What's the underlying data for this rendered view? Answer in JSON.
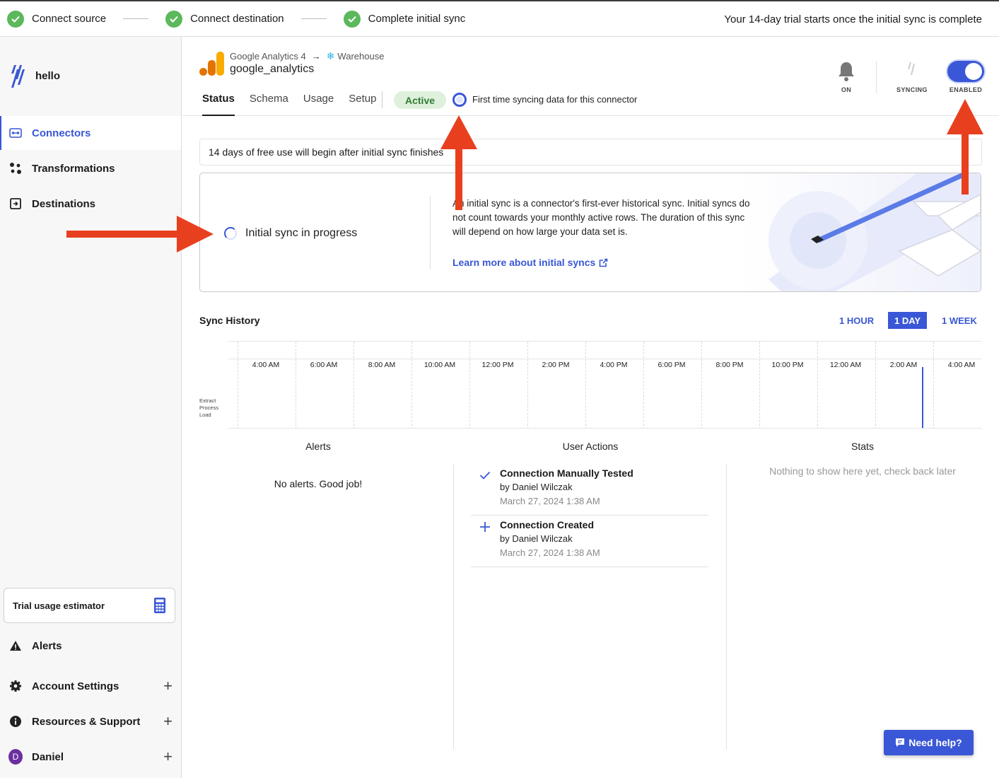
{
  "progress": {
    "steps": [
      {
        "label": "Connect source"
      },
      {
        "label": "Connect destination"
      },
      {
        "label": "Complete initial sync"
      }
    ],
    "trial_note": "Your 14-day trial starts once the initial sync is complete"
  },
  "sidebar": {
    "brand": "hello",
    "items": [
      {
        "label": "Connectors",
        "icon": "connectors-icon",
        "active": true
      },
      {
        "label": "Transformations",
        "icon": "transformations-icon"
      },
      {
        "label": "Destinations",
        "icon": "destinations-icon"
      }
    ],
    "trial_estimator": "Trial usage estimator",
    "bottom": [
      {
        "label": "Alerts",
        "icon": "warning-icon"
      },
      {
        "label": "Account Settings",
        "icon": "gear-icon"
      },
      {
        "label": "Resources & Support",
        "icon": "info-icon"
      },
      {
        "label": "Daniel",
        "avatar_initial": "D"
      }
    ]
  },
  "header": {
    "source": "Google Analytics 4",
    "destination": "Warehouse",
    "connector_name": "google_analytics",
    "tabs": [
      "Status",
      "Schema",
      "Usage",
      "Setup"
    ],
    "status_badge": "Active",
    "sync_message": "First time syncing data for this connector",
    "controls": {
      "notifications": "ON",
      "syncing": "SYNCING",
      "enabled": "ENABLED"
    }
  },
  "info_bar": "14 days of free use will begin after initial sync finishes",
  "initial_sync": {
    "status": "Initial sync in progress",
    "description": "An initial sync is a connector's first-ever historical sync. Initial syncs do not count towards your monthly active rows. The duration of this sync will depend on how large your data set is.",
    "link": "Learn more about initial syncs"
  },
  "sync_history": {
    "title": "Sync History",
    "ranges": [
      "1 HOUR",
      "1 DAY",
      "1 WEEK"
    ],
    "selected_range": "1 DAY",
    "row_labels": [
      "Extract",
      "Process",
      "Load"
    ],
    "ticks": [
      "2:00 AM",
      "4:00 AM",
      "6:00 AM",
      "8:00 AM",
      "10:00 AM",
      "12:00 PM",
      "2:00 PM",
      "4:00 PM",
      "6:00 PM",
      "8:00 PM",
      "10:00 PM",
      "12:00 AM",
      "2:00 AM",
      "4:00 AM"
    ]
  },
  "panels": {
    "alerts_title": "Alerts",
    "alerts_empty": "No alerts. Good job!",
    "actions_title": "User Actions",
    "actions": [
      {
        "icon": "check-icon",
        "title": "Connection Manually Tested",
        "by": "by Daniel Wilczak",
        "date": "March 27, 2024 1:38 AM"
      },
      {
        "icon": "plus-icon",
        "title": "Connection Created",
        "by": "by Daniel Wilczak",
        "date": "March 27, 2024 1:38 AM"
      }
    ],
    "stats_title": "Stats",
    "stats_empty": "Nothing to show here yet, check back later"
  },
  "help_button": "Need help?",
  "colors": {
    "accent": "#3957d6",
    "success": "#5cb85c",
    "annotation": "#e8401f"
  }
}
